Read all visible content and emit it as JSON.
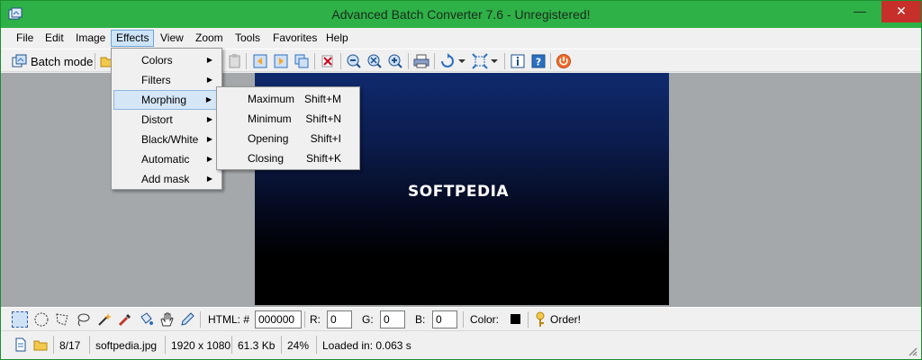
{
  "window": {
    "title": "Advanced Batch Converter 7.6 - Unregistered!"
  },
  "menubar": {
    "items": [
      "File",
      "Edit",
      "Image",
      "Effects",
      "View",
      "Zoom",
      "Tools",
      "Favorites",
      "Help"
    ]
  },
  "toolbar": {
    "batch_mode_label": "Batch mode"
  },
  "effects_menu": {
    "items": [
      "Colors",
      "Filters",
      "Morphing",
      "Distort",
      "Black/White",
      "Automatic",
      "Add mask"
    ],
    "highlighted": "Morphing"
  },
  "morphing_submenu": {
    "items": [
      {
        "label": "Maximum",
        "shortcut": "Shift+M"
      },
      {
        "label": "Minimum",
        "shortcut": "Shift+N"
      },
      {
        "label": "Opening",
        "shortcut": "Shift+I"
      },
      {
        "label": "Closing",
        "shortcut": "Shift+K"
      }
    ]
  },
  "canvas": {
    "logo_text": "SOFTPEDIA"
  },
  "colorbar": {
    "html_label": "HTML: #",
    "html_value": "000000",
    "r_label": "R:",
    "r_value": "0",
    "g_label": "G:",
    "g_value": "0",
    "b_label": "B:",
    "b_value": "0",
    "color_label": "Color:",
    "order_label": "Order!"
  },
  "status": {
    "index": "8/17",
    "filename": "softpedia.jpg",
    "dimensions": "1920 x 1080",
    "filesize": "61.3 Kb",
    "zoom": "24%",
    "loaded": "Loaded in: 0.063 s"
  },
  "colors": {
    "titlebar": "#2eb146",
    "close_button": "#c7302a",
    "workspace": "#a4a8ab",
    "menu_highlight": "#d5e6f7"
  }
}
